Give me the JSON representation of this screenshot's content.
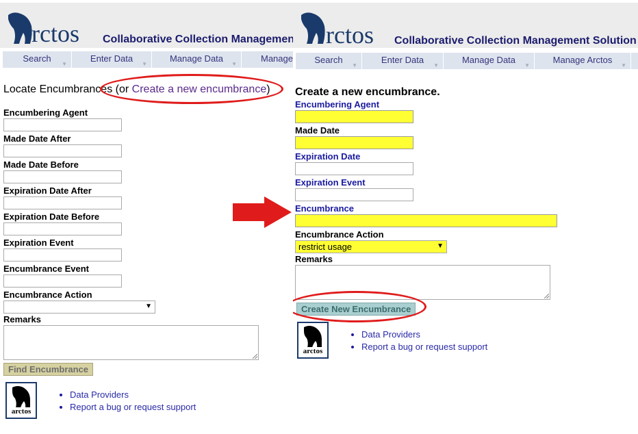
{
  "left": {
    "logo_text": "rctos",
    "app_title": "Collaborative Collection Managemen",
    "menu": [
      "Search",
      "Enter Data",
      "Manage Data",
      "Manage"
    ],
    "heading_prefix": "Locate Encumbrances (or ",
    "heading_link": "Create a new encumbrance",
    "heading_suffix": ")",
    "fields": [
      {
        "label": "Encumbering Agent",
        "value": ""
      },
      {
        "label": "Made Date After",
        "value": ""
      },
      {
        "label": "Made Date Before",
        "value": ""
      },
      {
        "label": "Expiration Date After",
        "value": ""
      },
      {
        "label": "Expiration Date Before",
        "value": ""
      },
      {
        "label": "Expiration Event",
        "value": ""
      },
      {
        "label": "Encumbrance Event",
        "value": ""
      }
    ],
    "action_label": "Encumbrance Action",
    "action_value": "",
    "remarks_label": "Remarks",
    "find_button": "Find Encumbrance",
    "links": [
      "Data Providers",
      "Report a bug or request support"
    ],
    "footer_logo_tag": "arctos"
  },
  "right": {
    "logo_text": "rctos",
    "app_title": "Collaborative Collection Management Solution",
    "menu": [
      "Search",
      "Enter Data",
      "Manage Data",
      "Manage Arctos"
    ],
    "heading": "Create a new encumbrance.",
    "fields": [
      {
        "label": "Encumbering Agent",
        "value": ""
      },
      {
        "label": "Made Date",
        "value": ""
      },
      {
        "label": "Expiration Date",
        "value": ""
      },
      {
        "label": "Expiration Event",
        "value": ""
      },
      {
        "label": "Encumbrance",
        "value": ""
      }
    ],
    "action_label": "Encumbrance Action",
    "action_value": "restrict usage",
    "remarks_label": "Remarks",
    "create_button": "Create New Encumbrance",
    "links": [
      "Data Providers",
      "Report a bug or request support"
    ],
    "footer_logo_tag": "arctos"
  },
  "colors": {
    "required_field": "#ffff33",
    "annotation_red": "#e01b1b",
    "required_label_blue": "#1a1aa0",
    "find_button_bg": "#d6d1a0",
    "create_button_bg": "#a9cfd0"
  },
  "icons": [
    "polar-bear-logo-icon",
    "right-arrow-annotation-icon",
    "dropdown-caret-icon"
  ]
}
